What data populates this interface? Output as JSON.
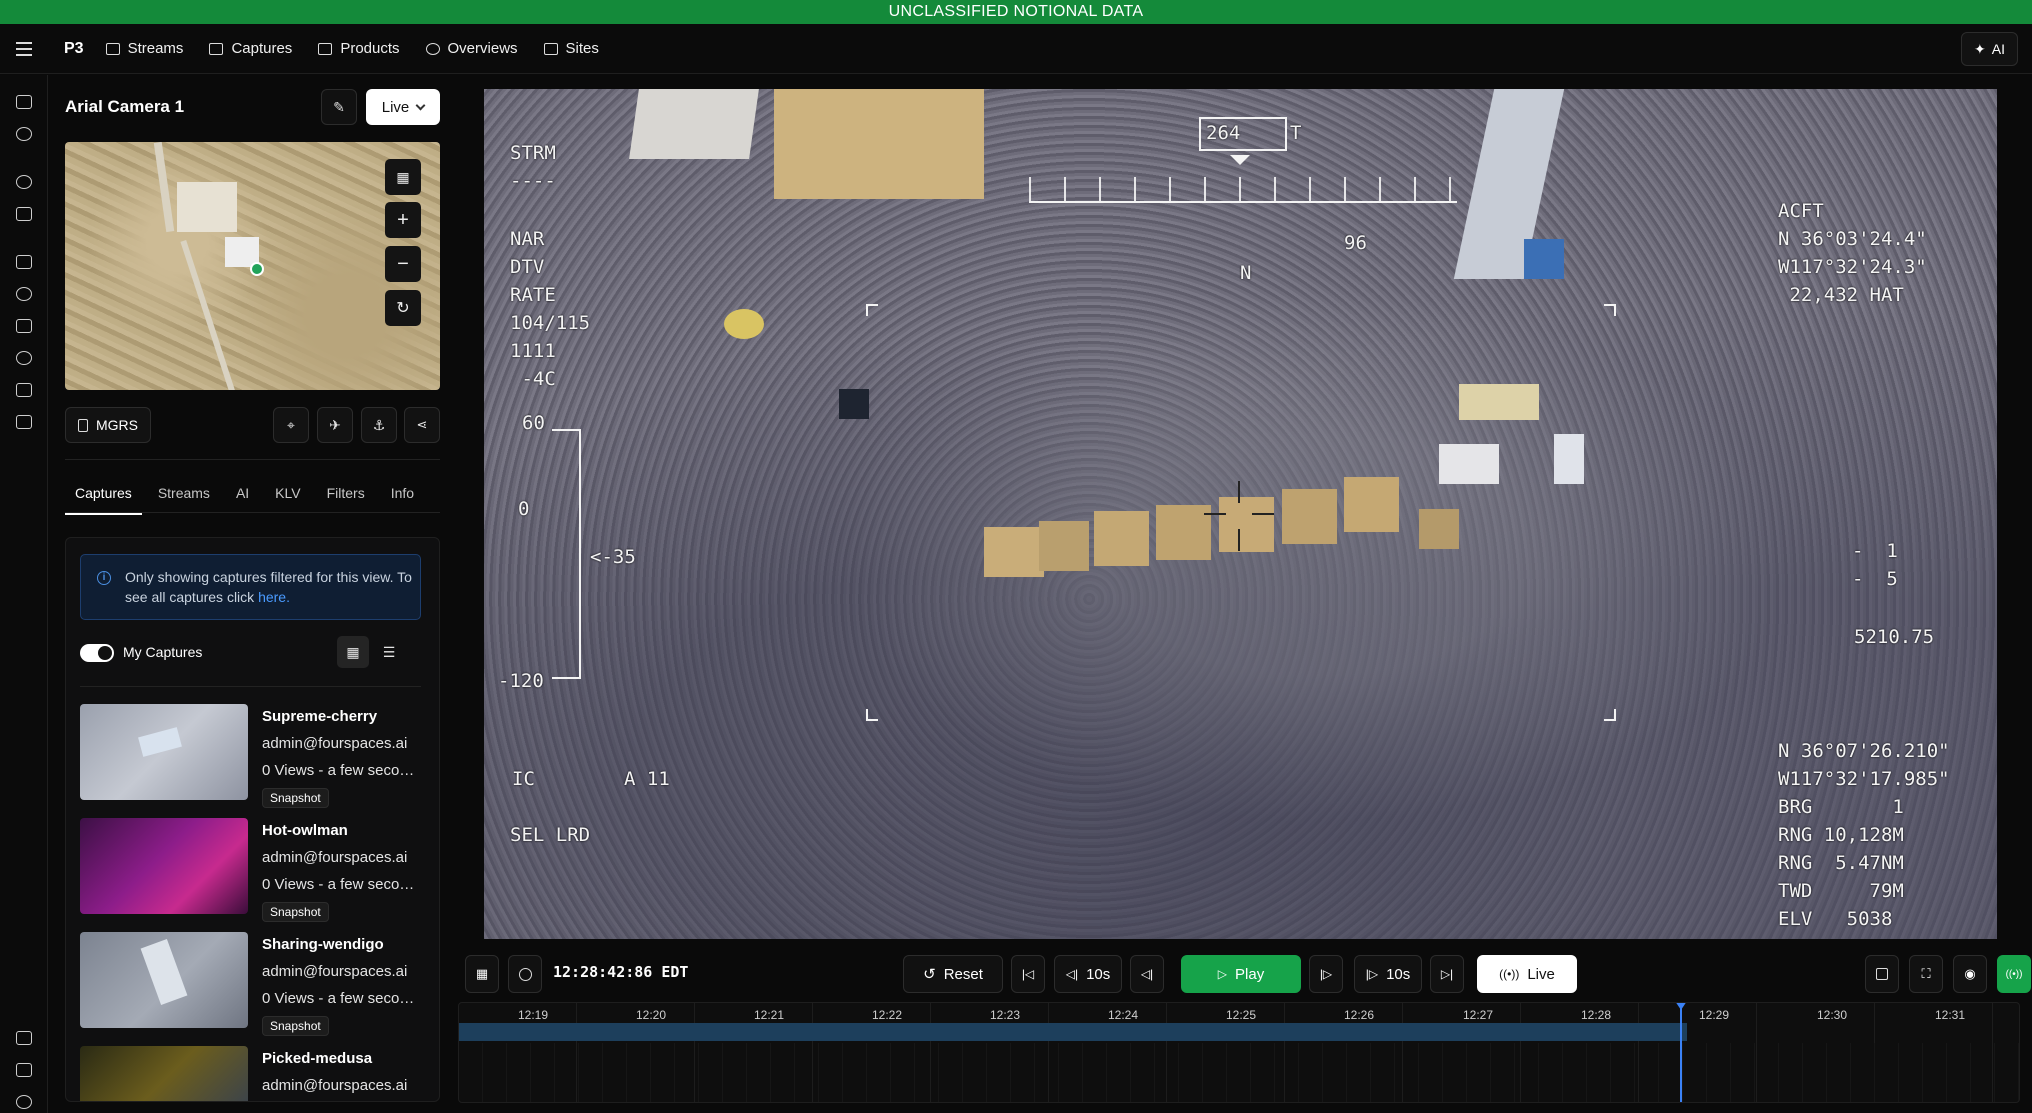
{
  "banner": "UNCLASSIFIED NOTIONAL DATA",
  "topnav": {
    "brand": "P3",
    "items": [
      {
        "label": "Streams",
        "icon": "video-icon"
      },
      {
        "label": "Captures",
        "icon": "image-icon"
      },
      {
        "label": "Products",
        "icon": "briefcase-icon"
      },
      {
        "label": "Overviews",
        "icon": "target-icon"
      },
      {
        "label": "Sites",
        "icon": "building-icon"
      }
    ],
    "ai_label": "AI"
  },
  "panel": {
    "camera_title": "Arial Camera 1",
    "mode_select": "Live",
    "mgrs_label": "MGRS",
    "tabs": [
      "Captures",
      "Streams",
      "AI",
      "KLV",
      "Filters",
      "Info"
    ],
    "active_tab": "Captures",
    "info_text": "Only showing captures filtered for this view. To see all captures click ",
    "info_link": "here.",
    "my_captures_label": "My Captures",
    "captures": [
      {
        "name": "Supreme-cherry",
        "user": "admin@fourspaces.ai",
        "meta": "0 Views - a few seconds ago",
        "badge": "Snapshot"
      },
      {
        "name": "Hot-owlman",
        "user": "admin@fourspaces.ai",
        "meta": "0 Views - a few seconds ago",
        "badge": "Snapshot"
      },
      {
        "name": "Sharing-wendigo",
        "user": "admin@fourspaces.ai",
        "meta": "0 Views - a few seconds ago",
        "badge": "Snapshot"
      },
      {
        "name": "Picked-medusa",
        "user": "admin@fourspaces.ai",
        "meta": "",
        "badge": ""
      }
    ]
  },
  "hud": {
    "left_top": "STRM\n----",
    "left_mid": "NAR\nDTV\nRATE\n104/115\n1111\n -4C",
    "scale_60": "60",
    "scale_0": "0",
    "scale_neg120": "-120",
    "scale_pointer": "<-35",
    "ic": "IC",
    "a11": "A 11",
    "sel": "SEL LRD",
    "heading_box": "264",
    "heading_t": "T",
    "heading_96": "96",
    "north": "N",
    "acft": "ACFT\nN 36°03'24.4\"\nW117°32'24.3\"\n 22,432 HAT",
    "right_mid": "-  1\n-  5",
    "right_val": "5210.75",
    "target": "N 36°07'26.210\"\nW117°32'17.985\"\nBRG       1\nRNG 10,128M\nRNG  5.47NM\nTWD     79M\nELV   5038"
  },
  "controls": {
    "time": "12:28:42:86  EDT",
    "reset": "Reset",
    "back10": "10s",
    "play": "Play",
    "fwd10": "10s",
    "live": "Live"
  },
  "timeline": {
    "ticks": [
      "12:19",
      "12:20",
      "12:21",
      "12:22",
      "12:23",
      "12:24",
      "12:25",
      "12:26",
      "12:27",
      "12:28",
      "12:29",
      "12:30",
      "12:31"
    ]
  },
  "colors": {
    "banner": "#148a3a",
    "accent_green": "#16a34a",
    "timeline_bar": "#1d3f5c",
    "playhead": "#3b82f6"
  }
}
